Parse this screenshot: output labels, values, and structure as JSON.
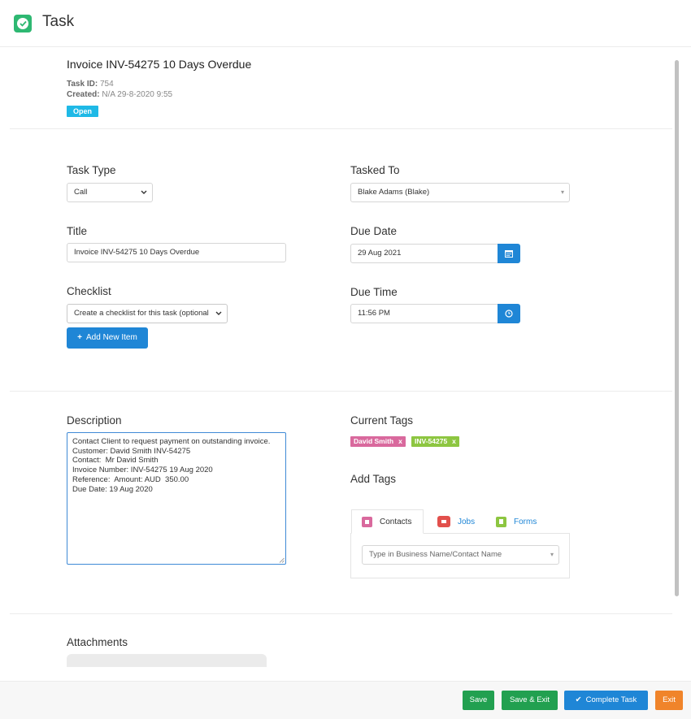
{
  "app": {
    "title": "Task"
  },
  "task": {
    "heading": "Invoice INV-54275  10 Days Overdue",
    "id_label": "Task ID:",
    "id_value": "754",
    "created_label": "Created:",
    "created_value": "N/A   29-8-2020 9:55",
    "status": "Open"
  },
  "form": {
    "task_type_label": "Task Type",
    "task_type_value": "Call",
    "tasked_to_label": "Tasked To",
    "tasked_to_value": "Blake Adams (Blake)",
    "title_label": "Title",
    "title_value": "Invoice INV-54275  10 Days Overdue",
    "due_date_label": "Due Date",
    "due_date_value": "29 Aug 2021",
    "checklist_label": "Checklist",
    "checklist_value": "Create a checklist for this task (optional",
    "due_time_label": "Due Time",
    "due_time_value": "11:56 PM",
    "add_item_label": "Add New Item"
  },
  "description": {
    "label": "Description",
    "lines": [
      "Contact Client to request payment on outstanding invoice.",
      "Customer: David Smith INV-54275",
      "Contact:  Mr David Smith",
      "Invoice Number: INV-54275 19 Aug 2020",
      "Reference:  Amount: AUD  350.00",
      "Due Date: 19 Aug 2020"
    ]
  },
  "tags": {
    "current_label": "Current Tags",
    "items": [
      {
        "text": "David Smith",
        "remove": "x",
        "color": "#d9699d"
      },
      {
        "text": "INV-54275",
        "remove": "x",
        "color": "#8dc641"
      }
    ],
    "add_label": "Add Tags",
    "tabs": [
      {
        "label": "Contacts",
        "icon": "contacts-icon",
        "color": "#d9699d"
      },
      {
        "label": "Jobs",
        "icon": "briefcase-icon",
        "color": "#e2504c"
      },
      {
        "label": "Forms",
        "icon": "document-icon",
        "color": "#8dc641"
      }
    ],
    "search_placeholder": "Type in Business Name/Contact Name"
  },
  "attachments": {
    "label": "Attachments"
  },
  "footer": {
    "save": "Save",
    "save_exit": "Save & Exit",
    "complete": "Complete Task",
    "exit": "Exit"
  },
  "colors": {
    "brand_green": "#2eb872",
    "accent_blue": "#1f86d6",
    "status_cyan": "#1fb9e6",
    "exit_orange": "#f0842a"
  }
}
